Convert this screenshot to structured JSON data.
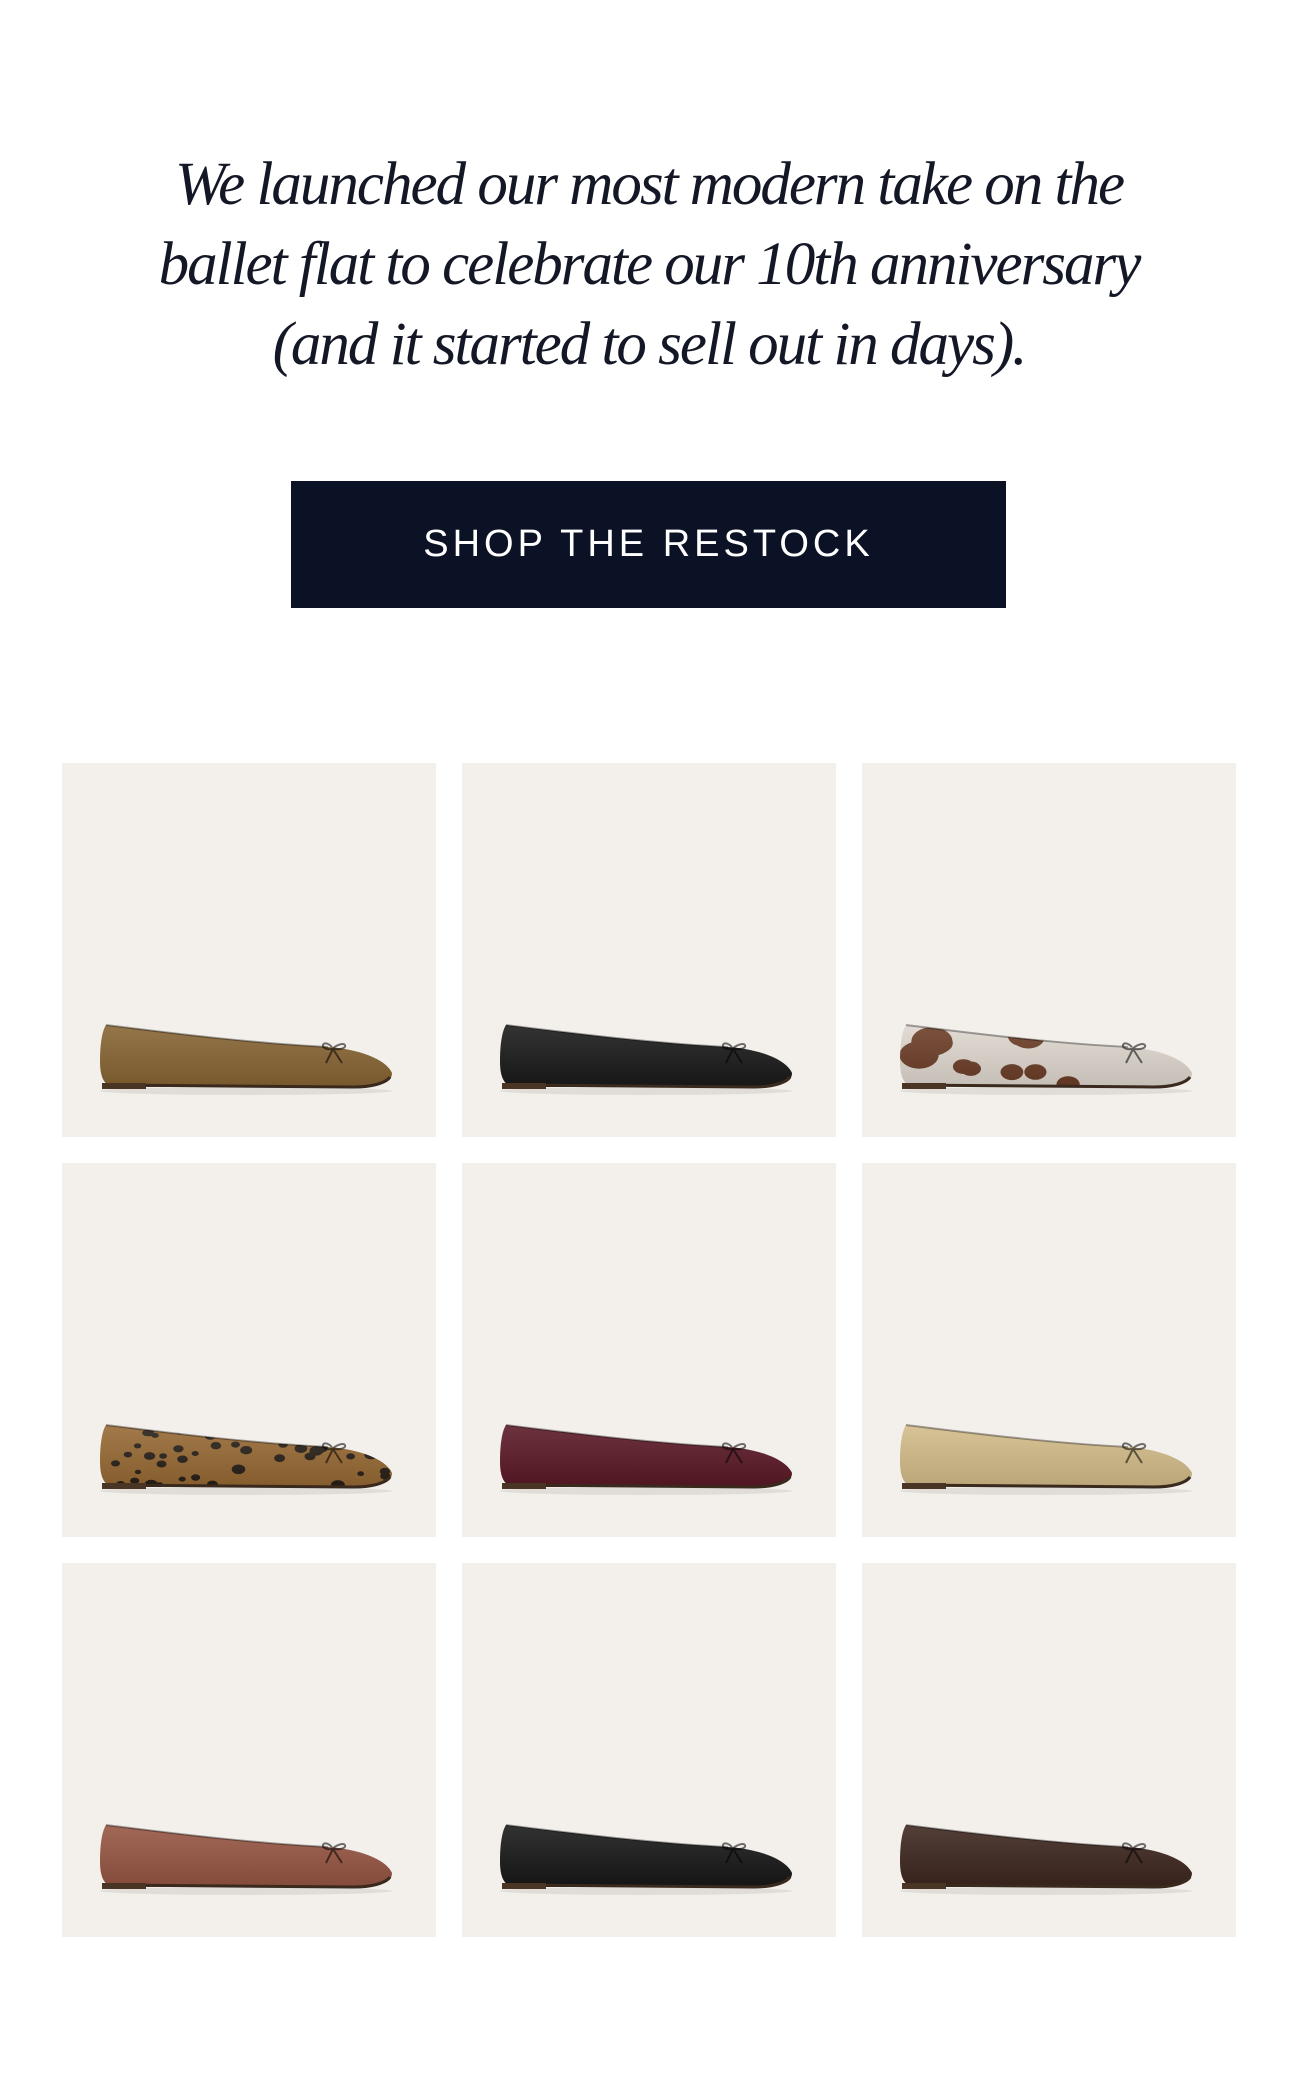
{
  "headline": {
    "line1": "We launched our most modern take on the",
    "line2": "ballet flat to celebrate our 10th anniversary",
    "line3": "(and it started to sell out in days)."
  },
  "cta": {
    "label": "SHOP THE RESTOCK",
    "background": "#0c1226"
  },
  "tile_background": "#f3f0ec",
  "products": [
    {
      "icon": "ballet-flat-image",
      "color": "#8a6530",
      "finish": "suede"
    },
    {
      "icon": "ballet-flat-image",
      "color": "#151414",
      "finish": "suede"
    },
    {
      "icon": "ballet-flat-image",
      "color": "#e9e1d8",
      "finish": "cow-print",
      "spot": "#6b3a22"
    },
    {
      "icon": "ballet-flat-image",
      "color": "#9b6a30",
      "finish": "leopard",
      "spot": "#231a12"
    },
    {
      "icon": "ballet-flat-image",
      "color": "#5a1320",
      "finish": "velvet"
    },
    {
      "icon": "ballet-flat-image",
      "color": "#dcc38c",
      "finish": "metallic"
    },
    {
      "icon": "ballet-flat-image",
      "color": "#9a5440",
      "finish": "leather"
    },
    {
      "icon": "ballet-flat-image",
      "color": "#121212",
      "finish": "patent"
    },
    {
      "icon": "ballet-flat-image",
      "color": "#3a2219",
      "finish": "suede"
    }
  ]
}
